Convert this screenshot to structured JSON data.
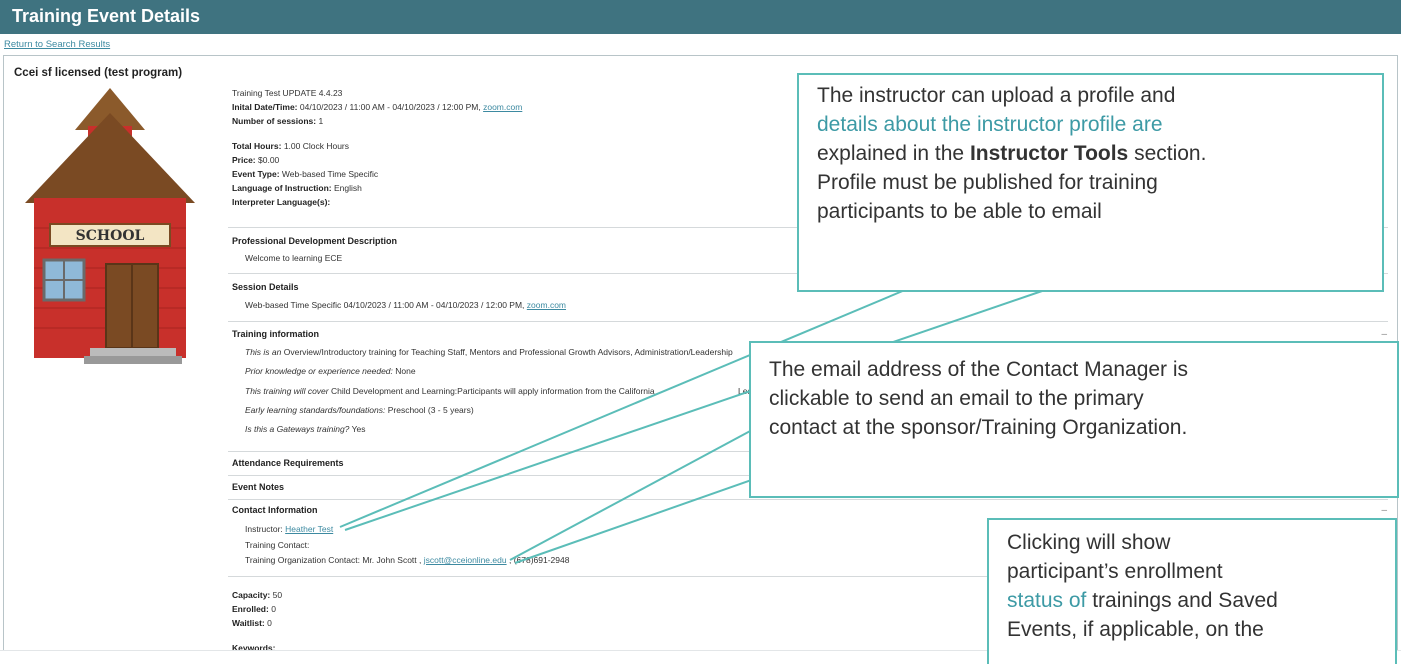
{
  "header": {
    "title": "Training Event Details"
  },
  "nav": {
    "return_link": "Return to Search Results"
  },
  "program": {
    "name": "Ccei sf licensed (test program)",
    "sign": "SCHOOL"
  },
  "event": {
    "title": "Training Test UPDATE 4.4.23",
    "initial_label": "Inital Date/Time:",
    "initial_value": "04/10/2023 / 11:00 AM - 04/10/2023 / 12:00 PM,",
    "initial_link": "zoom.com",
    "sessions_label": "Number of sessions:",
    "sessions_value": "1",
    "hours_label": "Total Hours:",
    "hours_value": "1.00 Clock Hours",
    "price_label": "Price:",
    "price_value": "$0.00",
    "type_label": "Event Type:",
    "type_value": "Web-based Time Specific",
    "language_label": "Language of Instruction:",
    "language_value": "English",
    "interpreter_label": "Interpreter Language(s):"
  },
  "pd": {
    "heading": "Professional Development Description",
    "text": "Welcome to learning ECE"
  },
  "session": {
    "heading": "Session Details",
    "text": "Web-based Time Specific 04/10/2023 / 11:00 AM - 04/10/2023 / 12:00 PM,",
    "link": "zoom.com"
  },
  "training_info": {
    "heading": "Training information",
    "line1_label": "This is an",
    "line1_value": "Overview/Introductory training for Teaching Staff, Mentors and Professional Growth Advisors, Administration/Leadership",
    "line2_label": "Prior knowledge or experience needed:",
    "line2_value": "None",
    "line3_label": "This training will cover",
    "line3_value": "Child Development and Learning:Participants will apply information from the California",
    "line3_tail": "Learn",
    "line4_label": "Early learning standards/foundations:",
    "line4_value": "Preschool (3 - 5 years)",
    "line5_label": "Is this a Gateways training?",
    "line5_value": "Yes"
  },
  "attendance": {
    "heading": "Attendance Requirements"
  },
  "notes": {
    "heading": "Event Notes"
  },
  "contact": {
    "heading": "Contact Information",
    "instructor_label": "Instructor:",
    "instructor_link": "Heather Test",
    "training_contact_label": "Training Contact:",
    "org_label": "Training Organization Contact: Mr. John Scott ,",
    "org_email": "jscott@cceionline.edu",
    "org_phone": ", (678)691-2948"
  },
  "stats": {
    "capacity_label": "Capacity:",
    "capacity_value": "50",
    "enrolled_label": "Enrolled:",
    "enrolled_value": "0",
    "waitlist_label": "Waitlist:",
    "waitlist_value": "0",
    "keywords_label": "Keywords:"
  },
  "callouts": {
    "instructor_1": "The instructor can upload a profile and",
    "instructor_2": "details about the instructor profile are",
    "instructor_3a": "explained in the ",
    "instructor_3b": "Instructor Tools",
    "instructor_3c": " section.",
    "instructor_4": "Profile must be published for training",
    "instructor_5": "participants to be able to email",
    "email_1": "The email address of the Contact Manager is",
    "email_2": "clickable to send an email to the primary",
    "email_3": "contact at the sponsor/Training Organization.",
    "click_1": "Clicking will show",
    "click_2": "participant’s enrollment",
    "click_3a": "status of",
    "click_3b": " trainings and Saved",
    "click_4": "Events, if applicable, on the"
  },
  "colors": {
    "header": "#3f7380",
    "callout_border": "#5bbdb8",
    "link": "#3d8aa1"
  }
}
